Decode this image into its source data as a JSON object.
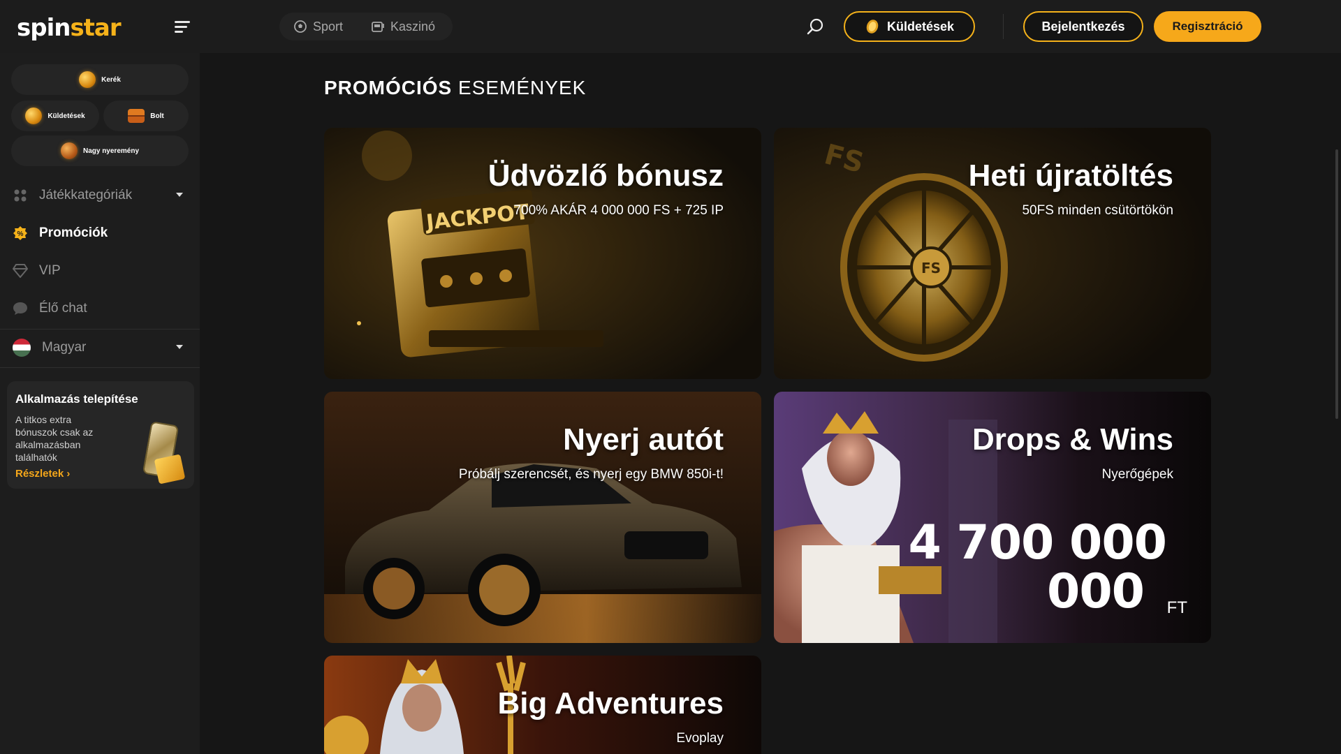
{
  "brand": {
    "part1": "spin",
    "part2": "star"
  },
  "topnav": [
    {
      "label": "Sport",
      "icon": "soccer-ball-icon"
    },
    {
      "label": "Kaszinó",
      "icon": "slot-machine-icon"
    }
  ],
  "header": {
    "missions_label": "Küldetések",
    "login_label": "Bejelentkezés",
    "register_label": "Regisztráció"
  },
  "sidebar": {
    "chips": {
      "wheel": "Kerék",
      "missions": "Küldetések",
      "shop": "Bolt",
      "jackpot": "Nagy nyeremény"
    },
    "items": [
      {
        "label": "Játékkategóriák",
        "icon": "grid-icon"
      },
      {
        "label": "Promóciók",
        "icon": "promo-badge-icon"
      },
      {
        "label": "VIP",
        "icon": "diamond-icon"
      },
      {
        "label": "Élő chat",
        "icon": "chat-bubble-icon"
      }
    ],
    "language": "Magyar",
    "app_card": {
      "title": "Alkalmazás telepítése",
      "description": "A titkos extra bónuszok csak az alkalmazásban találhatók",
      "link": "Részletek ›"
    }
  },
  "page": {
    "title_bold": "PROMÓCIÓS",
    "title_rest": "ESEMÉNYEK"
  },
  "promos": [
    {
      "title": "Üdvözlő bónusz",
      "subtitle": "700% AKÁR 4 000 000 FS + 725 IP",
      "art_text": "JACKPOT"
    },
    {
      "title": "Heti újratöltés",
      "subtitle": "50FS minden csütörtökön",
      "art_text": "FS"
    },
    {
      "title": "Nyerj autót",
      "subtitle": "Próbálj szerencsét, és nyerj egy BMW 850i-t!"
    },
    {
      "title": "Drops & Wins",
      "subtitle": "Nyerőgépek",
      "jackpot_line1": "4 700 000",
      "jackpot_line2": "000",
      "currency": "FT"
    },
    {
      "title": "Big Adventures",
      "subtitle": "Evoplay"
    }
  ],
  "colors": {
    "accent": "#f5b21a",
    "register_bg": "#f6a81a",
    "bg": "#161616",
    "sidebar_bg": "#1d1d1d"
  }
}
